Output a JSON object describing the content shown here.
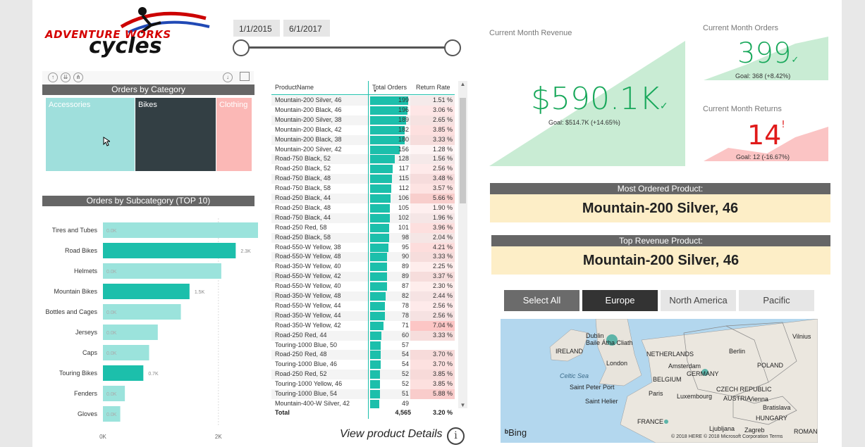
{
  "logo": {
    "line1": "ADVENTURE WORKS",
    "line2": "cycles"
  },
  "date_range": {
    "start": "1/1/2015",
    "end": "6/1/2017"
  },
  "orders_by_category": {
    "title": "Orders by Category",
    "items": [
      {
        "label": "Accessories",
        "color": "#9fdfdc"
      },
      {
        "label": "Bikes",
        "color": "#333f44"
      },
      {
        "label": "Clothing",
        "color": "#fbb8b6"
      }
    ]
  },
  "orders_by_subcategory": {
    "title": "Orders by Subcategory (TOP 10)",
    "axis_ticks": [
      "0K",
      "2K"
    ]
  },
  "chart_data": {
    "type": "bar",
    "categories": [
      "Tires and Tubes",
      "Road Bikes",
      "Helmets",
      "Mountain Bikes",
      "Bottles and Cages",
      "Jerseys",
      "Caps",
      "Touring Bikes",
      "Fenders",
      "Gloves"
    ],
    "values": [
      2.8,
      2.3,
      2.05,
      1.5,
      1.35,
      0.95,
      0.8,
      0.7,
      0.38,
      0.3
    ],
    "data_labels": [
      "0.0K",
      "2.3K",
      "0.0K",
      "1.5K",
      "0.0K",
      "0.0K",
      "0.0K",
      "0.7K",
      "0.0K",
      "0.0K"
    ],
    "highlighted": [
      false,
      true,
      false,
      true,
      false,
      false,
      false,
      true,
      false,
      false
    ],
    "xlim": [
      0,
      3.0
    ],
    "xlabel": "",
    "ylabel": "",
    "colors": {
      "light": "#9be3dc",
      "dark": "#1cbfab"
    }
  },
  "product_table": {
    "headers": {
      "name": "ProductName",
      "orders": "Total Orders",
      "rate": "Return Rate"
    },
    "rows": [
      {
        "name": "Mountain-200 Silver, 46",
        "orders": 199,
        "rate": "1.51 %"
      },
      {
        "name": "Mountain-200 Black, 46",
        "orders": 196,
        "rate": "3.06 %"
      },
      {
        "name": "Mountain-200 Silver, 38",
        "orders": 189,
        "rate": "2.65 %"
      },
      {
        "name": "Mountain-200 Black, 42",
        "orders": 182,
        "rate": "3.85 %"
      },
      {
        "name": "Mountain-200 Black, 38",
        "orders": 180,
        "rate": "3.33 %"
      },
      {
        "name": "Mountain-200 Silver, 42",
        "orders": 156,
        "rate": "1.28 %"
      },
      {
        "name": "Road-750 Black, 52",
        "orders": 128,
        "rate": "1.56 %"
      },
      {
        "name": "Road-250 Black, 52",
        "orders": 117,
        "rate": "2.56 %"
      },
      {
        "name": "Road-750 Black, 48",
        "orders": 115,
        "rate": "3.48 %"
      },
      {
        "name": "Road-750 Black, 58",
        "orders": 112,
        "rate": "3.57 %"
      },
      {
        "name": "Road-250 Black, 44",
        "orders": 106,
        "rate": "5.66 %"
      },
      {
        "name": "Road-250 Black, 48",
        "orders": 105,
        "rate": "1.90 %"
      },
      {
        "name": "Road-750 Black, 44",
        "orders": 102,
        "rate": "1.96 %"
      },
      {
        "name": "Road-250 Red, 58",
        "orders": 101,
        "rate": "3.96 %"
      },
      {
        "name": "Road-250 Black, 58",
        "orders": 98,
        "rate": "2.04 %"
      },
      {
        "name": "Road-550-W Yellow, 38",
        "orders": 95,
        "rate": "4.21 %"
      },
      {
        "name": "Road-550-W Yellow, 48",
        "orders": 90,
        "rate": "3.33 %"
      },
      {
        "name": "Road-350-W Yellow, 40",
        "orders": 89,
        "rate": "2.25 %"
      },
      {
        "name": "Road-550-W Yellow, 42",
        "orders": 89,
        "rate": "3.37 %"
      },
      {
        "name": "Road-550-W Yellow, 40",
        "orders": 87,
        "rate": "2.30 %"
      },
      {
        "name": "Road-350-W Yellow, 48",
        "orders": 82,
        "rate": "2.44 %"
      },
      {
        "name": "Road-550-W Yellow, 44",
        "orders": 78,
        "rate": "2.56 %"
      },
      {
        "name": "Road-350-W Yellow, 44",
        "orders": 78,
        "rate": "2.56 %"
      },
      {
        "name": "Road-350-W Yellow, 42",
        "orders": 71,
        "rate": "7.04 %"
      },
      {
        "name": "Road-250 Red, 44",
        "orders": 60,
        "rate": "3.33 %"
      },
      {
        "name": "Touring-1000 Blue, 50",
        "orders": 57,
        "rate": ""
      },
      {
        "name": "Road-250 Red, 48",
        "orders": 54,
        "rate": "3.70 %"
      },
      {
        "name": "Touring-1000 Blue, 46",
        "orders": 54,
        "rate": "3.70 %"
      },
      {
        "name": "Road-250 Red, 52",
        "orders": 52,
        "rate": "3.85 %"
      },
      {
        "name": "Touring-1000 Yellow, 46",
        "orders": 52,
        "rate": "3.85 %"
      },
      {
        "name": "Touring-1000 Blue, 54",
        "orders": 51,
        "rate": "5.88 %"
      },
      {
        "name": "Mountain-400-W Silver, 42",
        "orders": 49,
        "rate": ""
      }
    ],
    "total": {
      "label": "Total",
      "orders": "4,565",
      "rate": "3.20 %"
    }
  },
  "view_details": "View product Details",
  "kpi": {
    "revenue": {
      "title": "Current Month Revenue",
      "value": "$590.1K",
      "goal": "Goal: $514.7K (+14.65%)"
    },
    "orders": {
      "title": "Current Month Orders",
      "value": "399",
      "goal": "Goal: 368 (+8.42%)"
    },
    "returns": {
      "title": "Current Month Returns",
      "value": "14",
      "goal": "Goal: 12 (-16.67%)"
    }
  },
  "most_ordered": {
    "title": "Most Ordered Product:",
    "value": "Mountain-200 Silver, 46"
  },
  "top_revenue": {
    "title": "Top Revenue Product:",
    "value": "Mountain-200 Silver, 46"
  },
  "region_slicer": {
    "items": [
      "Select All",
      "Europe",
      "North America",
      "Pacific"
    ],
    "selected": "Europe"
  },
  "map": {
    "labels": [
      "IRELAND",
      "Dublin",
      "Baile Átha Cliath",
      "Celtic Sea",
      "Saint Peter Port",
      "Saint Helier",
      "London",
      "NETHERLANDS",
      "Amsterdam",
      "BELGIUM",
      "Paris",
      "Luxembourg",
      "GERMANY",
      "Berlin",
      "POLAND",
      "CZECH REPUBLIC",
      "AUSTRIA",
      "Vienna",
      "Bratislava",
      "HUNGARY",
      "FRANCE",
      "Ljubljana",
      "Zagreb",
      "ROMAN",
      "Vilnius"
    ],
    "brand": "Bing",
    "copyright": "© 2018 HERE © 2018 Microsoft Corporation Terms"
  }
}
